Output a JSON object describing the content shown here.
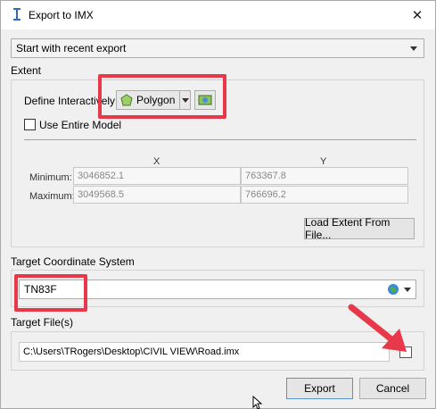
{
  "window": {
    "title": "Export to IMX",
    "close_glyph": "✕"
  },
  "recent": {
    "value": "Start with recent export"
  },
  "extent": {
    "label": "Extent",
    "define_label": "Define Interactively:",
    "method_value": "Polygon",
    "use_entire_model": "Use Entire Model",
    "x_header": "X",
    "y_header": "Y",
    "minimum_label": "Minimum:",
    "maximum_label": "Maximum:",
    "min_x": "3046852.1",
    "min_y": "763367.8",
    "max_x": "3049568.5",
    "max_y": "766696.2",
    "load_button": "Load Extent From File..."
  },
  "coordinate": {
    "label": "Target Coordinate System",
    "value": "TN83F"
  },
  "files": {
    "label": "Target File(s)",
    "path": "C:\\Users\\TRogers\\Desktop\\CIVIL VIEW\\Road.imx"
  },
  "footer": {
    "export": "Export",
    "cancel": "Cancel"
  },
  "colors": {
    "annotation_red": "#e8384a",
    "accent_blue": "#5a8fd0"
  }
}
